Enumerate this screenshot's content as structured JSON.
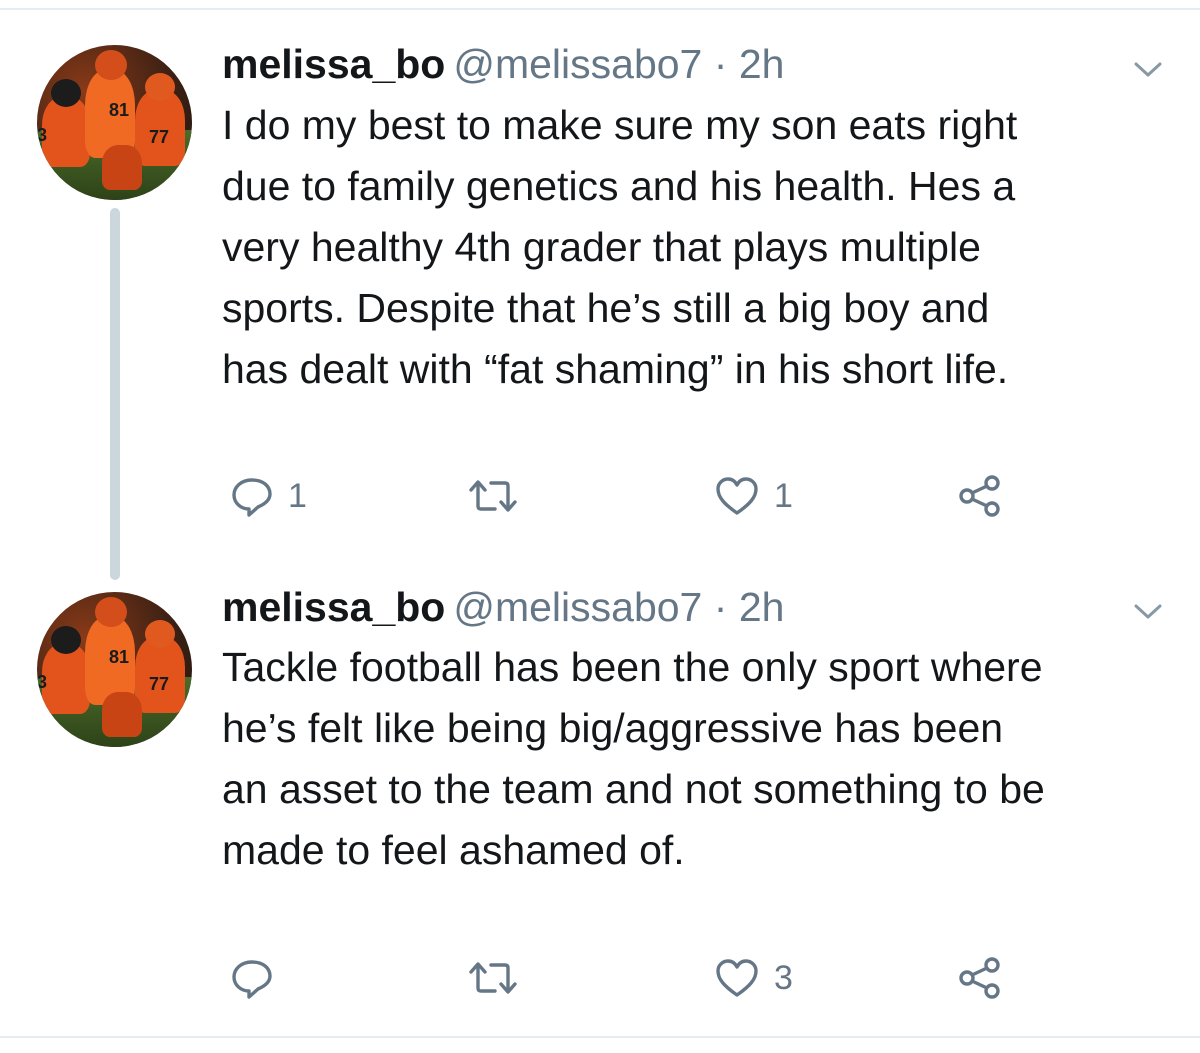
{
  "tweets": [
    {
      "display_name": "melissa_bo",
      "handle": "@melissabo7",
      "separator": "·",
      "time": "2h",
      "text": "I do my best to make sure my son eats right\ndue to family genetics and his health. Hes a\nvery healthy 4th grader that plays multiple\nsports. Despite that he’s still a big boy and\nhas dealt with “fat shaming” in his short life.",
      "reply_count": "1",
      "retweet_count": "",
      "like_count": "1"
    },
    {
      "display_name": "melissa_bo",
      "handle": "@melissabo7",
      "separator": "·",
      "time": "2h",
      "text": "Tackle football has been the only sport where\nhe’s felt like being big/aggressive  has been\nan asset to the team and not something to be\nmade to feel ashamed of.",
      "reply_count": "",
      "retweet_count": "",
      "like_count": "3"
    }
  ],
  "avatar_numbers": [
    "81",
    "77",
    "3"
  ],
  "icons": {
    "reply": "reply-icon",
    "retweet": "retweet-icon",
    "like": "heart-icon",
    "share": "share-icon",
    "menu": "chevron-down-icon"
  },
  "colors": {
    "text": "#14171a",
    "secondary": "#657786",
    "thread_line": "#ccd6dd",
    "divider": "#e6ecf0"
  }
}
